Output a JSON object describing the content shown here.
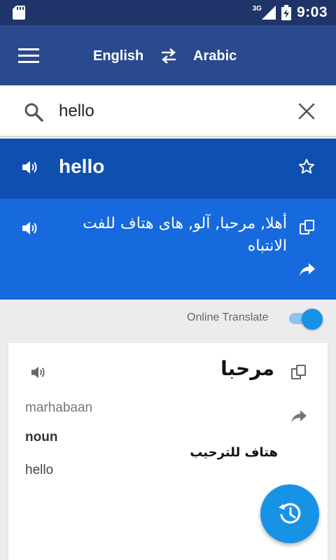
{
  "status_bar": {
    "network": "3G",
    "time": "9:03",
    "icons": [
      "sd-card-icon",
      "signal-icon",
      "battery-icon"
    ]
  },
  "header": {
    "lang_from": "English",
    "lang_to": "Arabic",
    "icons": [
      "menu-icon",
      "swap-icon"
    ]
  },
  "search": {
    "value": "hello",
    "placeholder": ""
  },
  "source": {
    "word": "hello"
  },
  "translation": {
    "text": "أهلا, مرحبا, آلو, هاى هتاف للفت الانتباه"
  },
  "online_translate": {
    "label": "Online Translate",
    "enabled": true
  },
  "entry": {
    "word": "مرحبا",
    "transliteration": "marhabaan",
    "part_of_speech": "noun",
    "definition": "هتاف للترحيب",
    "meaning": "hello"
  },
  "colors": {
    "status_bar": "#1f3468",
    "app_bar": "#2a4a8f",
    "source_band": "#0e4fb0",
    "translation_band": "#1769de",
    "accent": "#1793e6"
  }
}
